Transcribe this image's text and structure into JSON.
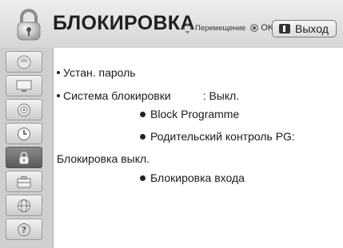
{
  "header": {
    "title": "БЛОКИРОВКА",
    "nav_hint": "Перемещение",
    "ok_label": "OK",
    "exit_label": "Выход"
  },
  "sidebar": {
    "items": [
      {
        "name": "picture",
        "icon": "picture-icon",
        "active": false
      },
      {
        "name": "screen",
        "icon": "monitor-icon",
        "active": false
      },
      {
        "name": "sound",
        "icon": "speaker-icon",
        "active": false
      },
      {
        "name": "time",
        "icon": "clock-icon",
        "active": false
      },
      {
        "name": "lock",
        "icon": "lock-icon",
        "active": true
      },
      {
        "name": "option",
        "icon": "suitcase-icon",
        "active": false
      },
      {
        "name": "network",
        "icon": "globe-icon",
        "active": false
      },
      {
        "name": "support",
        "icon": "question-icon",
        "active": false
      }
    ]
  },
  "menu": {
    "set_password": "Устан. пароль",
    "lock_system_label": "Система блокировки",
    "lock_system_value": ": Выкл.",
    "block_programme": "Block Programme",
    "parental_control": "Родительский контроль PG:",
    "lock_off_note": "Блокировка выкл.",
    "input_block": "Блокировка входа"
  },
  "colors": {
    "header_top": "#eeeeee",
    "sidebar_bg": "#cfcfcf",
    "active_item": "#6e6e6e"
  }
}
